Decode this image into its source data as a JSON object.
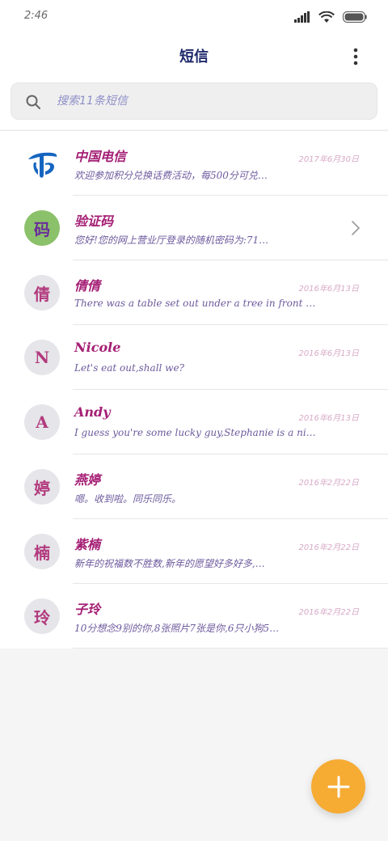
{
  "status_bar": {
    "time": "2:46",
    "icons": [
      "signal-icon",
      "wifi-icon",
      "battery-icon"
    ]
  },
  "header": {
    "title": "短信",
    "more_icon": "more-vertical-icon"
  },
  "search": {
    "placeholder": "搜索11条短信",
    "icon": "search-icon"
  },
  "conversations": [
    {
      "name": "中国电信",
      "date": "2017年6月30日",
      "preview": "欢迎参加积分兑换话费活动，每500分可兑…",
      "avatar": "",
      "avatar_style": "telecom"
    },
    {
      "name": "验证码",
      "date": "",
      "preview": "您好!您的网上营业厅登录的随机密码为:71…",
      "avatar": "码",
      "avatar_style": "green",
      "has_chevron": true
    },
    {
      "name": "倩倩",
      "date": "2016年6月13日",
      "preview": "There was a table set out under a tree in front of t…",
      "avatar": "倩",
      "avatar_style": "gray"
    },
    {
      "name": "Nicole",
      "date": "2016年6月13日",
      "preview": "Let's eat out,shall we?",
      "avatar": "N",
      "avatar_style": "gray"
    },
    {
      "name": "Andy",
      "date": "2016年6月13日",
      "preview": "I guess you're some lucky guy,Stephanie is a nice girl.",
      "avatar": "A",
      "avatar_style": "gray"
    },
    {
      "name": "燕婷",
      "date": "2016年2月22日",
      "preview": "嗯。收到啦。同乐同乐。",
      "avatar": "婷",
      "avatar_style": "gray"
    },
    {
      "name": "紫楠",
      "date": "2016年2月22日",
      "preview": "新年的祝福数不胜数,新年的愿望好多好多,…",
      "avatar": "楠",
      "avatar_style": "gray"
    },
    {
      "name": "子玲",
      "date": "2016年2月22日",
      "preview": "10分想念9别的你,8张照片7张是你,6只小狗5…",
      "avatar": "玲",
      "avatar_style": "gray"
    }
  ],
  "fab": {
    "icon": "plus-icon"
  },
  "colors": {
    "accent": "#f6ab33",
    "name_text": "#a51f75",
    "preview_text": "#6c5a9d",
    "telecom_blue": "#1565c0",
    "avatar_green": "#8bc16a"
  }
}
